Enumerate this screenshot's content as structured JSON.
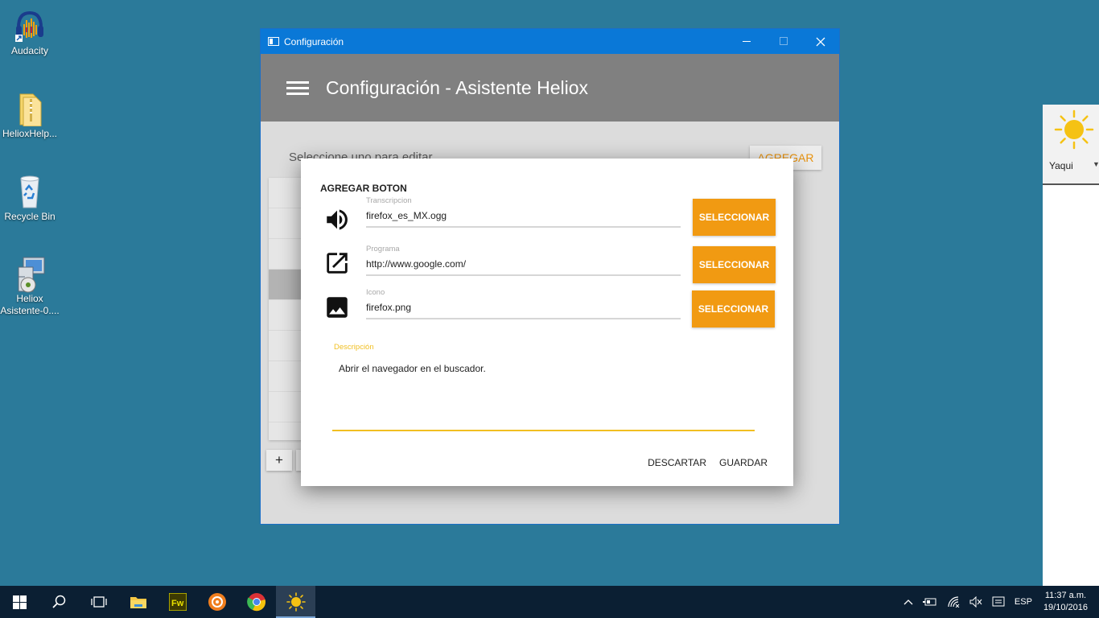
{
  "desktop": {
    "icons": [
      {
        "label": "Audacity"
      },
      {
        "label": "HelioxHelp..."
      },
      {
        "label": "Recycle Bin"
      },
      {
        "label": "Heliox Asistente-0...."
      }
    ]
  },
  "window": {
    "title": "Configuración",
    "app_title": "Configuración - Asistente Heliox",
    "select_label": "Seleccione uno para editar",
    "agregar_label": "AGREGAR",
    "plus_label": "+"
  },
  "dialog": {
    "heading": "AGREGAR BOTON",
    "fields": [
      {
        "label": "Transcripcion",
        "value": "firefox_es_MX.ogg",
        "icon": "volume-icon",
        "button": "SELECCIONAR"
      },
      {
        "label": "Programa",
        "value": "http://www.google.com/",
        "icon": "open-in-new-icon",
        "button": "SELECCIONAR"
      },
      {
        "label": "Icono",
        "value": "firefox.png",
        "icon": "image-icon",
        "button": "SELECCIONAR"
      }
    ],
    "description_label": "Descripción",
    "description_value": "Abrir el navegador en el buscador.",
    "discard_label": "DESCARTAR",
    "save_label": "GUARDAR"
  },
  "side_panel": {
    "name": "Yaqui"
  },
  "taskbar": {
    "language": "ESP",
    "time": "11:37 a.m.",
    "date": "19/10/2016"
  },
  "colors": {
    "desktop": "#2b7a9a",
    "titlebar": "#0a78d7",
    "appbar": "#808080",
    "accent": "#f19a12",
    "focus_line": "#f1bf21"
  }
}
